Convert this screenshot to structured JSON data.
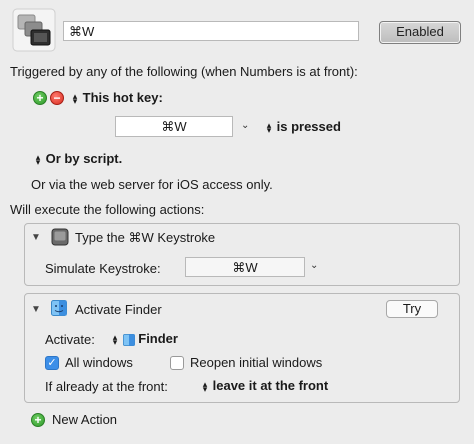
{
  "header": {
    "macro_name": "⌘W",
    "enabled_label": "Enabled"
  },
  "trigger": {
    "heading": "Triggered by any of the following (when Numbers is at front):",
    "hotkey_label": "This hot key:",
    "hotkey_value": "⌘W",
    "pressed_label": "is pressed",
    "script_label": "Or by script.",
    "web_label": "Or via the web server for iOS access only."
  },
  "actions": {
    "heading": "Will execute the following actions:",
    "keystroke": {
      "title": "Type the ⌘W Keystroke",
      "simulate_label": "Simulate Keystroke:",
      "simulate_value": "⌘W"
    },
    "finder": {
      "title": "Activate Finder",
      "try_label": "Try",
      "activate_label": "Activate:",
      "app_value": "Finder",
      "all_windows_label": "All windows",
      "all_windows_checked": true,
      "reopen_label": "Reopen initial windows",
      "reopen_checked": false,
      "front_label": "If already at the front:",
      "front_value": "leave it at the front"
    },
    "new_action_label": "New Action"
  },
  "colors": {
    "background": "#ececec",
    "check_blue": "#3d8fe8",
    "add_green": "#2f9a2a",
    "remove_red": "#d92d20"
  }
}
